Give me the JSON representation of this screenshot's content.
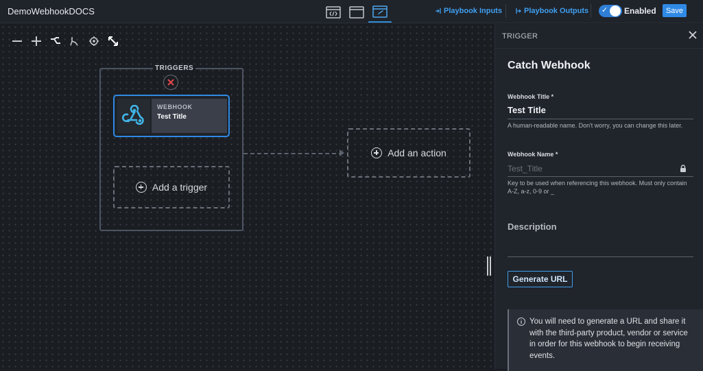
{
  "header": {
    "app_title": "DemoWebhookDOCS",
    "view_buttons": [
      {
        "icon": "code-view-icon"
      },
      {
        "icon": "window-view-icon"
      },
      {
        "icon": "edit-view-icon",
        "active": true
      }
    ],
    "playbook_inputs_label": "Playbook Inputs",
    "playbook_outputs_label": "Playbook Outputs",
    "enabled_label": "Enabled",
    "enabled": true,
    "save_label": "Save"
  },
  "canvas": {
    "toolbar_icons": [
      "zoom-out-icon",
      "zoom-in-icon",
      "branch-icon",
      "merge-icon",
      "target-icon",
      "fit-expand-icon"
    ],
    "triggers_group": {
      "title": "TRIGGERS",
      "node": {
        "kind": "WEBHOOK",
        "title": "Test Title",
        "icon": "webhook-icon"
      },
      "add_trigger_label": "Add a trigger"
    },
    "add_action_label": "Add an action"
  },
  "panel": {
    "header_label": "TRIGGER",
    "title": "Catch Webhook",
    "webhook_title": {
      "label": "Webhook Title *",
      "value": "Test Title",
      "help": "A human-readable name. Don't worry, you can change this later."
    },
    "webhook_name": {
      "label": "Webhook Name *",
      "placeholder": "Test_Title",
      "help": "Key to be used when referencing this webhook. Must only contain A-Z, a-z, 0-9 or _"
    },
    "description_label": "Description",
    "generate_url_label": "Generate URL",
    "info_text": "You will need to generate a URL and share it with the third-party product, vendor or service in order for this webhook to begin receiving events."
  },
  "colors": {
    "accent": "#2f8ae6",
    "link": "#3fa0f0",
    "danger": "#e5484d",
    "background": "#1b1e24"
  }
}
